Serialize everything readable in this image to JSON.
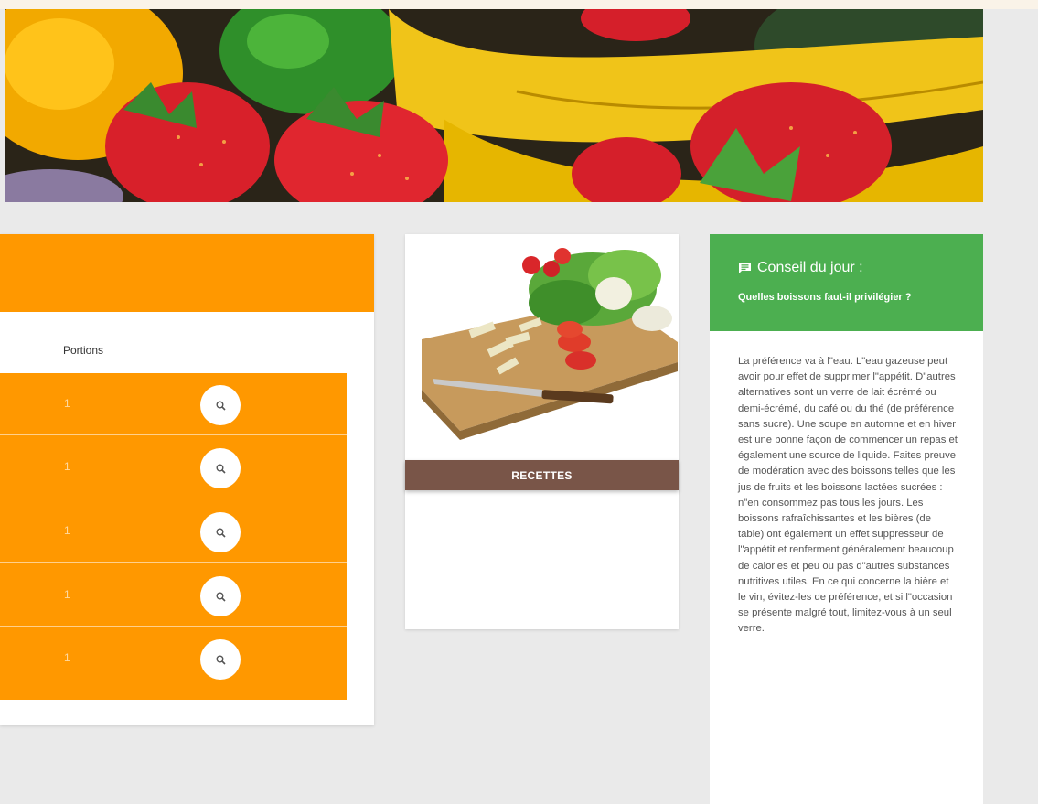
{
  "portions": {
    "label": "Portions",
    "rows": [
      {
        "value": "1",
        "action": "search-icon"
      },
      {
        "value": "1",
        "action": "search-icon"
      },
      {
        "value": "1",
        "action": "search-icon"
      },
      {
        "value": "1",
        "action": "search-icon"
      },
      {
        "value": "1",
        "action": "search-icon"
      }
    ]
  },
  "recipes": {
    "button_label": "RECETTES"
  },
  "tip": {
    "title": "Conseil du jour :",
    "subtitle": "Quelles boissons faut-il privilégier ?",
    "body": "La préférence va à l\"eau. L\"eau gazeuse peut avoir pour effet de supprimer l\"appétit. D\"autres alternatives sont un verre de lait écrémé ou demi-écrémé, du café ou du thé (de préférence sans sucre). Une soupe en automne et en hiver est une bonne façon de commencer un repas et également une source de liquide. Faites preuve de modération avec des boissons telles que les jus de fruits et les boissons lactées sucrées : n\"en consommez pas tous les jours. Les boissons rafraîchissantes et les bières (de table) ont également un effet suppresseur de l\"appétit et renferment généralement beaucoup de calories et peu ou pas d\"autres substances nutritives utiles. En ce qui concerne la bière et le vin, évitez-les de préférence, et si l\"occasion se présente malgré tout, limitez-vous à un seul verre.",
    "icon": "message-icon"
  },
  "colors": {
    "orange": "#ff9800",
    "green": "#4caf50",
    "brown": "#795548",
    "background": "#eaeaea"
  }
}
